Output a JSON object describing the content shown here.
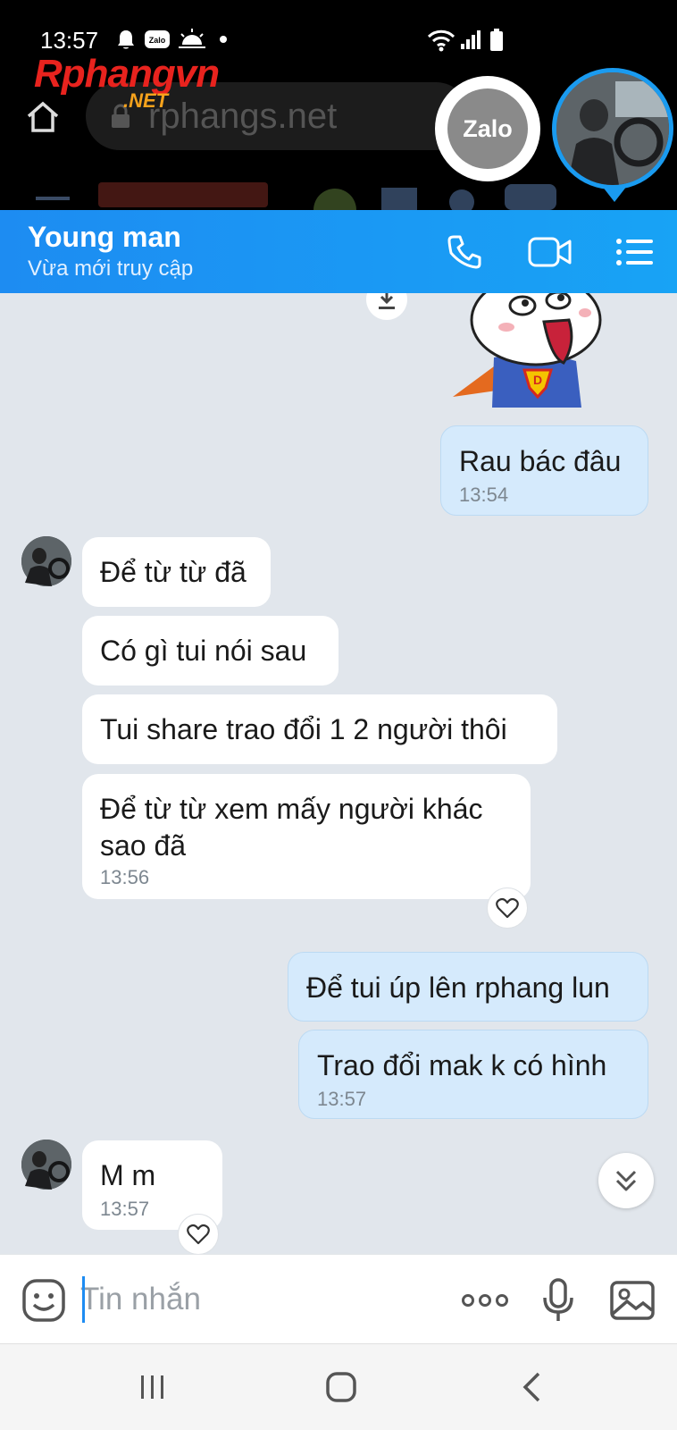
{
  "status_bar": {
    "time": "13:57",
    "icons": [
      "notification-bell-icon",
      "zalo-notification-icon",
      "weather-icon",
      "wifi-icon",
      "signal-icon",
      "battery-icon"
    ],
    "zalo_badge": "Zalo"
  },
  "browser": {
    "url": "rphangs.net",
    "site_logo": "Rphangvn",
    "site_logo_suffix": ".NET"
  },
  "floating": {
    "zalo_label": "Zalo"
  },
  "header": {
    "contact_name": "Young man",
    "status": "Vừa mới truy cập",
    "accent": "#1d8cf2"
  },
  "messages": [
    {
      "side": "out",
      "text": "Rau bác đâu",
      "time": "13:54"
    },
    {
      "side": "in",
      "text": "Để từ từ đã"
    },
    {
      "side": "in",
      "text": "Có gì tui nói sau"
    },
    {
      "side": "in",
      "text": "Tui share trao đổi 1 2 người thôi"
    },
    {
      "side": "in",
      "text_line1": "Để từ từ xem mấy người khác",
      "text_line2": "sao đã",
      "time": "13:56"
    },
    {
      "side": "out",
      "text": "Để tui úp lên rphang lun"
    },
    {
      "side": "out",
      "text": "Trao đổi mak k có hình",
      "time": "13:57"
    },
    {
      "side": "in",
      "text": "M m",
      "time": "13:57"
    }
  ],
  "input": {
    "placeholder": "Tin nhắn",
    "value": ""
  },
  "colors": {
    "incoming_bubble": "#ffffff",
    "outgoing_bubble": "#d5eafc",
    "chat_background": "#e1e6ec"
  }
}
